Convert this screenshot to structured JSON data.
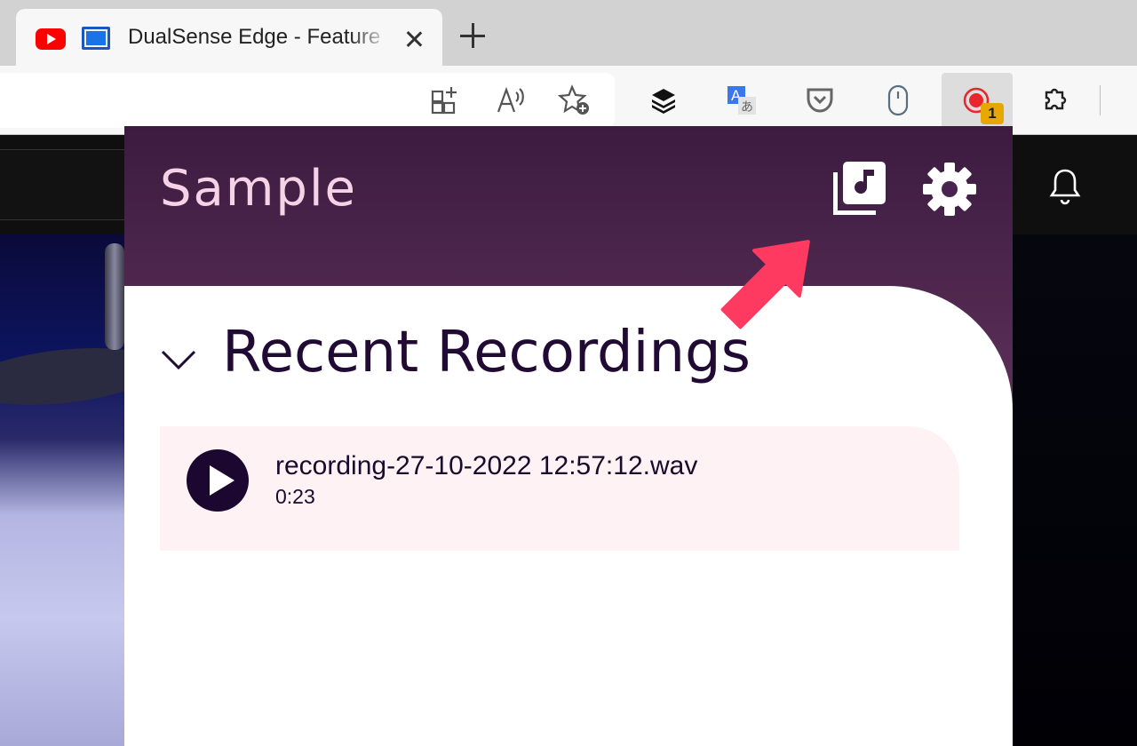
{
  "browser": {
    "tab": {
      "title": "DualSense Edge - Feature",
      "favicon": "youtube-icon",
      "secondary_icon": "screen-icon"
    },
    "toolbar_icons": [
      "app-grid-add-icon",
      "read-aloud-icon",
      "favorite-add-icon",
      "stacks-icon",
      "translate-icon",
      "pocket-icon",
      "mouse-icon",
      "record-icon",
      "extensions-puzzle-icon"
    ],
    "extension_badge": "1"
  },
  "popup": {
    "title": "Sample",
    "section_title": "Recent Recordings",
    "recordings": [
      {
        "name": "recording-27-10-2022 12:57:12.wav",
        "duration": "0:23"
      }
    ]
  },
  "colors": {
    "header_top": "#3c1b40",
    "header_bottom": "#8a5675",
    "title": "#f6d2e6",
    "card_bg": "#fff2f4",
    "play_button": "#1c0730",
    "arrow": "#ff3a60",
    "badge": "#e6a700"
  }
}
